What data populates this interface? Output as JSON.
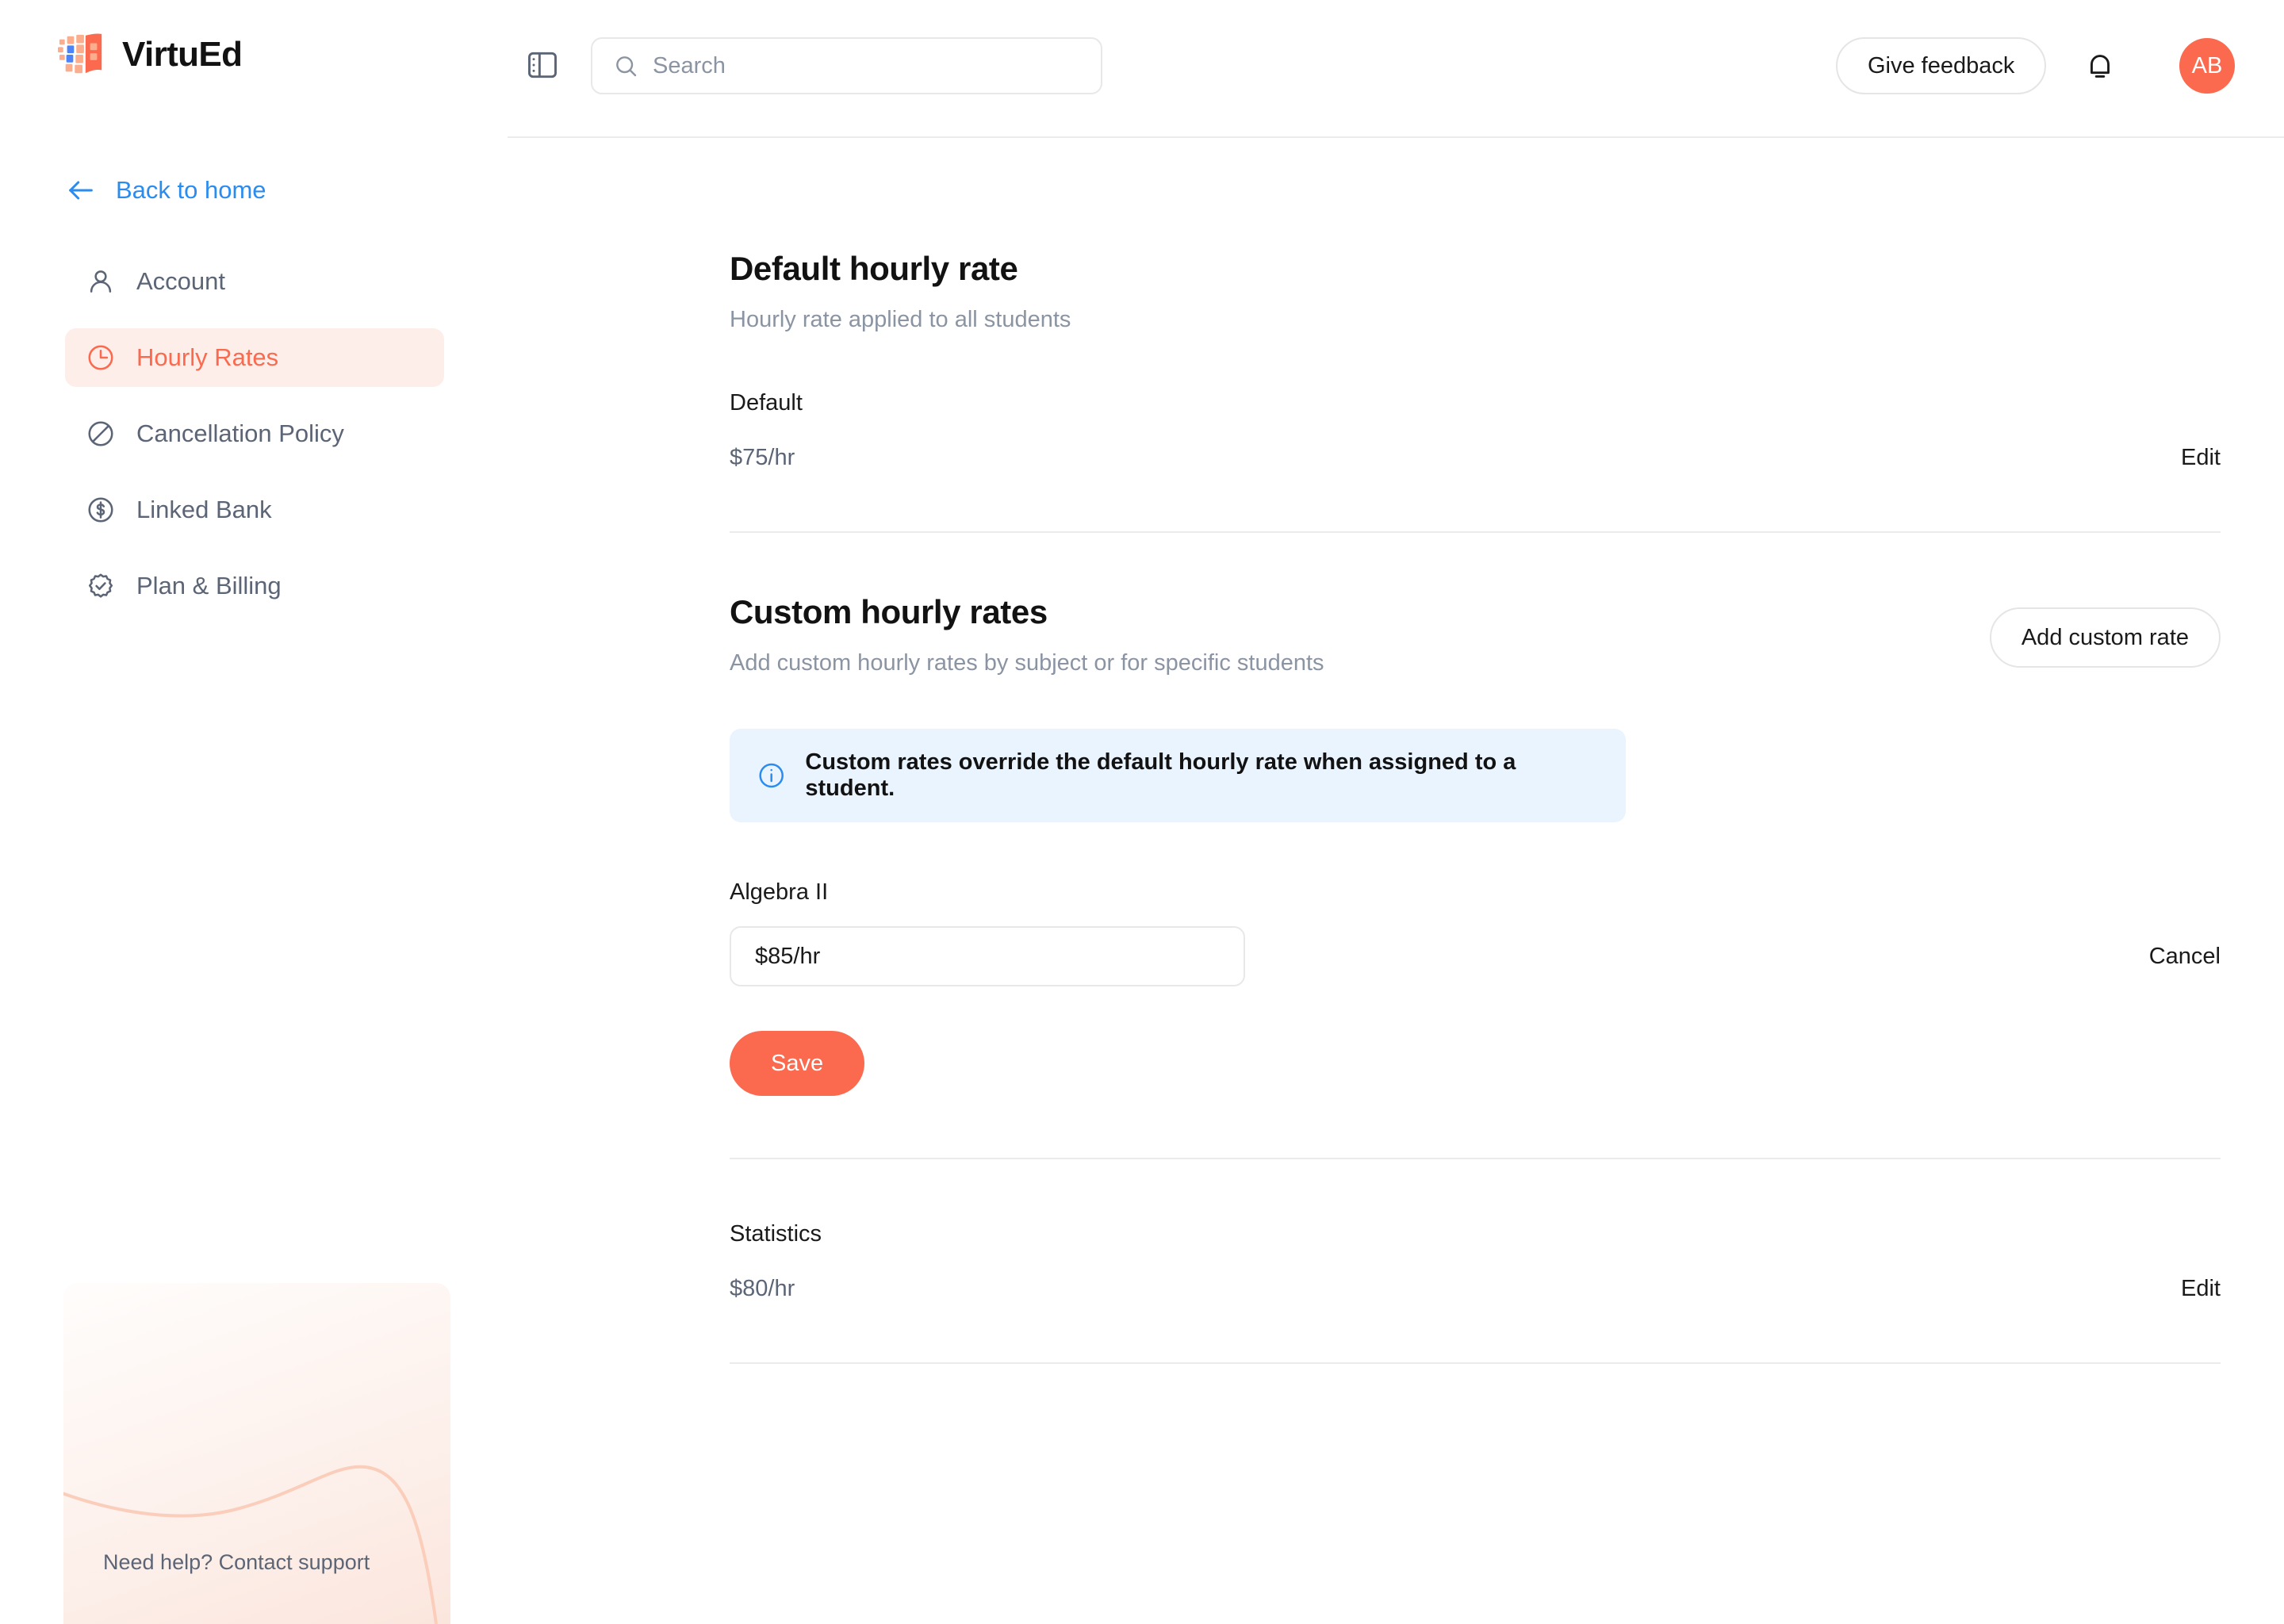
{
  "brand": {
    "name": "VirtuEd",
    "accent": "#FB6A4E"
  },
  "header": {
    "search_placeholder": "Search",
    "give_feedback_label": "Give feedback",
    "avatar_initials": "AB"
  },
  "sidebar": {
    "back_label": "Back to home",
    "items": [
      {
        "label": "Account",
        "icon": "user-icon",
        "active": false
      },
      {
        "label": "Hourly Rates",
        "icon": "clock-icon",
        "active": true
      },
      {
        "label": "Cancellation Policy",
        "icon": "ban-icon",
        "active": false
      },
      {
        "label": "Linked Bank",
        "icon": "dollar-circle-icon",
        "active": false
      },
      {
        "label": "Plan & Billing",
        "icon": "badge-check-icon",
        "active": false
      }
    ],
    "help_text": "Need help? Contact support"
  },
  "main": {
    "default_section": {
      "title": "Default hourly rate",
      "subtitle": "Hourly rate applied to all students",
      "row_label": "Default",
      "row_value": "$75/hr",
      "edit_label": "Edit"
    },
    "custom_section": {
      "title": "Custom hourly rates",
      "subtitle": "Add custom hourly rates by subject or for specific students",
      "add_button_label": "Add custom rate",
      "info_text": "Custom rates override the default hourly rate when assigned to a student.",
      "editing_row": {
        "label": "Algebra II",
        "input_value": "$85/hr",
        "input_placeholder": "$85/hr",
        "cancel_label": "Cancel",
        "save_label": "Save"
      },
      "rows": [
        {
          "label": "Statistics",
          "value": "$80/hr",
          "edit_label": "Edit"
        }
      ]
    }
  }
}
